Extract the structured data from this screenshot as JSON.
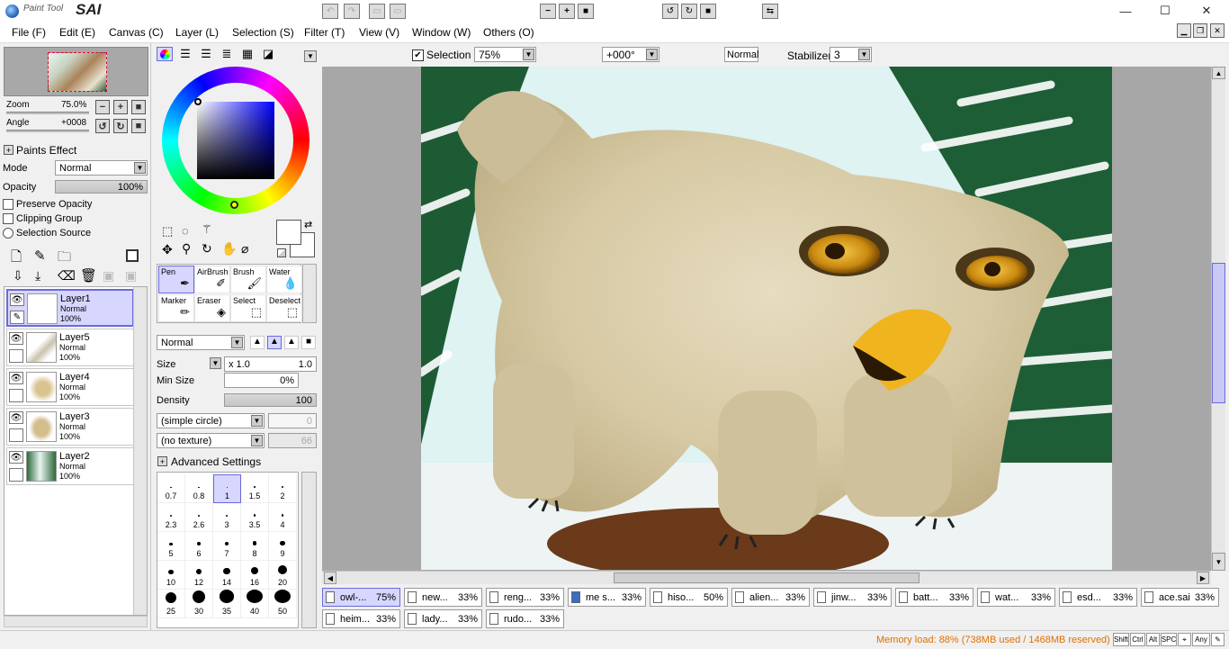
{
  "app": {
    "logo_small": "Paint Tool",
    "logo_big": "SAI"
  },
  "window_controls": {
    "minimize": "—",
    "maximize": "☐",
    "close": "✕"
  },
  "menu": [
    "File (F)",
    "Edit (E)",
    "Canvas (C)",
    "Layer (L)",
    "Selection (S)",
    "Filter (T)",
    "View (V)",
    "Window (W)",
    "Others (O)"
  ],
  "navigator": {
    "zoom_label": "Zoom",
    "zoom_value": "75.0%",
    "angle_label": "Angle",
    "angle_value": "+0008"
  },
  "paints_effect": {
    "header": "Paints Effect",
    "mode_label": "Mode",
    "mode_value": "Normal",
    "opacity_label": "Opacity",
    "opacity_value": "100%",
    "preserve_opacity": "Preserve Opacity",
    "clipping_group": "Clipping Group",
    "selection_source": "Selection Source"
  },
  "layers": [
    {
      "name": "Layer1",
      "mode": "Normal",
      "opacity": "100%",
      "selected": true
    },
    {
      "name": "Layer5",
      "mode": "Normal",
      "opacity": "100%",
      "selected": false
    },
    {
      "name": "Layer4",
      "mode": "Normal",
      "opacity": "100%",
      "selected": false
    },
    {
      "name": "Layer3",
      "mode": "Normal",
      "opacity": "100%",
      "selected": false
    },
    {
      "name": "Layer2",
      "mode": "Normal",
      "opacity": "100%",
      "selected": false
    }
  ],
  "tools": [
    "Pen",
    "AirBrush",
    "Brush",
    "Water",
    "Marker",
    "Eraser",
    "Select",
    "Deselect"
  ],
  "brush": {
    "blend_mode": "Normal",
    "size_label": "Size",
    "size_mult": "x 1.0",
    "size_value": "1.0",
    "min_size_label": "Min Size",
    "min_size_value": "0%",
    "density_label": "Density",
    "density_value": "100",
    "shape": "(simple circle)",
    "shape_value": "0",
    "texture": "(no texture)",
    "texture_value": "66",
    "advanced": "Advanced Settings",
    "sizes": [
      "0.7",
      "0.8",
      "1",
      "1.5",
      "2",
      "2.3",
      "2.6",
      "3",
      "3.5",
      "4",
      "5",
      "6",
      "7",
      "8",
      "9",
      "10",
      "12",
      "14",
      "16",
      "20",
      "25",
      "30",
      "35",
      "40",
      "50"
    ]
  },
  "toolbar": {
    "selection_label": "Selection",
    "zoom": "75%",
    "rotation": "+000°",
    "blend": "Normal",
    "stabilizer_label": "Stabilizer",
    "stabilizer_value": "3"
  },
  "tabs": [
    {
      "name": "owl-...",
      "zoom": "75%",
      "active": true
    },
    {
      "name": "new...",
      "zoom": "33%"
    },
    {
      "name": "reng...",
      "zoom": "33%"
    },
    {
      "name": "me s...",
      "zoom": "33%"
    },
    {
      "name": "hiso...",
      "zoom": "50%"
    },
    {
      "name": "alien...",
      "zoom": "33%"
    },
    {
      "name": "jinw...",
      "zoom": "33%"
    },
    {
      "name": "batt...",
      "zoom": "33%"
    },
    {
      "name": "wat...",
      "zoom": "33%"
    },
    {
      "name": "esd...",
      "zoom": "33%"
    },
    {
      "name": "ace.sai",
      "zoom": "33%"
    },
    {
      "name": "heim...",
      "zoom": "33%"
    },
    {
      "name": "lady...",
      "zoom": "33%"
    },
    {
      "name": "rudo...",
      "zoom": "33%"
    }
  ],
  "status": {
    "memory": "Memory load: 88% (738MB used / 1468MB reserved)",
    "keys": [
      "Shift",
      "Ctrl",
      "Alt",
      "SPC",
      "⌖",
      "Any",
      "✎"
    ]
  },
  "colors": {
    "accent": "#6a6ad8",
    "selected_bg": "#d6d6ff",
    "memory_text": "#e07000"
  }
}
